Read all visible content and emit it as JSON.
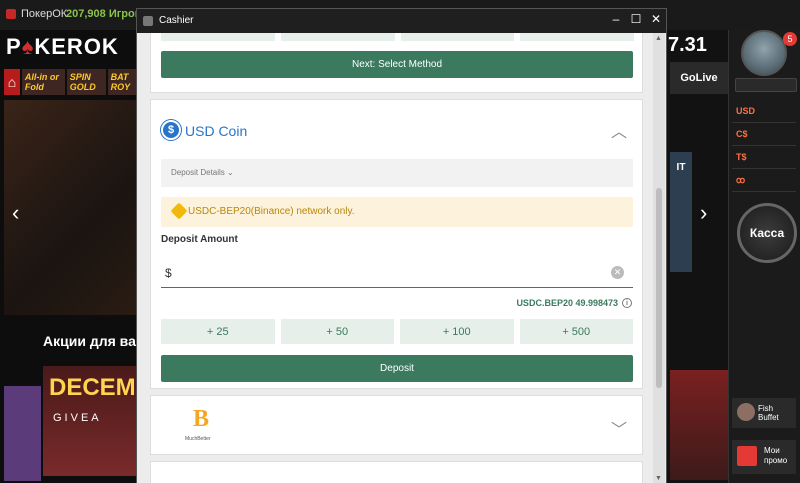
{
  "bg_app": {
    "title": "ПокерОК",
    "players": "207,908 Игроков с",
    "logo_left": "P",
    "logo_red": "♠",
    "logo_right": "KEROK",
    "games": [
      "All-in or Fold",
      "SPIN GOLD",
      "BAT ROY"
    ],
    "promo_heading": "Акции для ва",
    "promo_card_title": "DECEM",
    "promo_card_sub": "GIVEA",
    "right_num": "7.31",
    "golive": "GoLive",
    "right_banner": "IT",
    "currencies": [
      "USD",
      "C$",
      "T$",
      "ꝏ"
    ],
    "kassa": "Касса",
    "notif_count": "5",
    "fish_buffet": "Fish Buffet",
    "my_promos": "Мои промо"
  },
  "cashier": {
    "title": "Cashier",
    "next_button": "Next: Select Method",
    "method_name": "USD Coin",
    "usdc_symbol": "$",
    "deposit_details": "Deposit Details ⌄",
    "network_note": "USDC-BEP20(Binance) network only.",
    "deposit_amount_label": "Deposit Amount",
    "amount_value": "$",
    "balance": "USDC.BEP20 49.998473",
    "quick_amounts": [
      "+ 25",
      "+ 50",
      "+ 100",
      "+ 500"
    ],
    "deposit_button": "Deposit",
    "muchbetter_symbol": "B",
    "muchbetter_name": "MuchBetter"
  },
  "colors": {
    "accent_green": "#3b7a5e",
    "usdc_blue": "#2775ca",
    "note_bg": "#fdf3dc"
  }
}
